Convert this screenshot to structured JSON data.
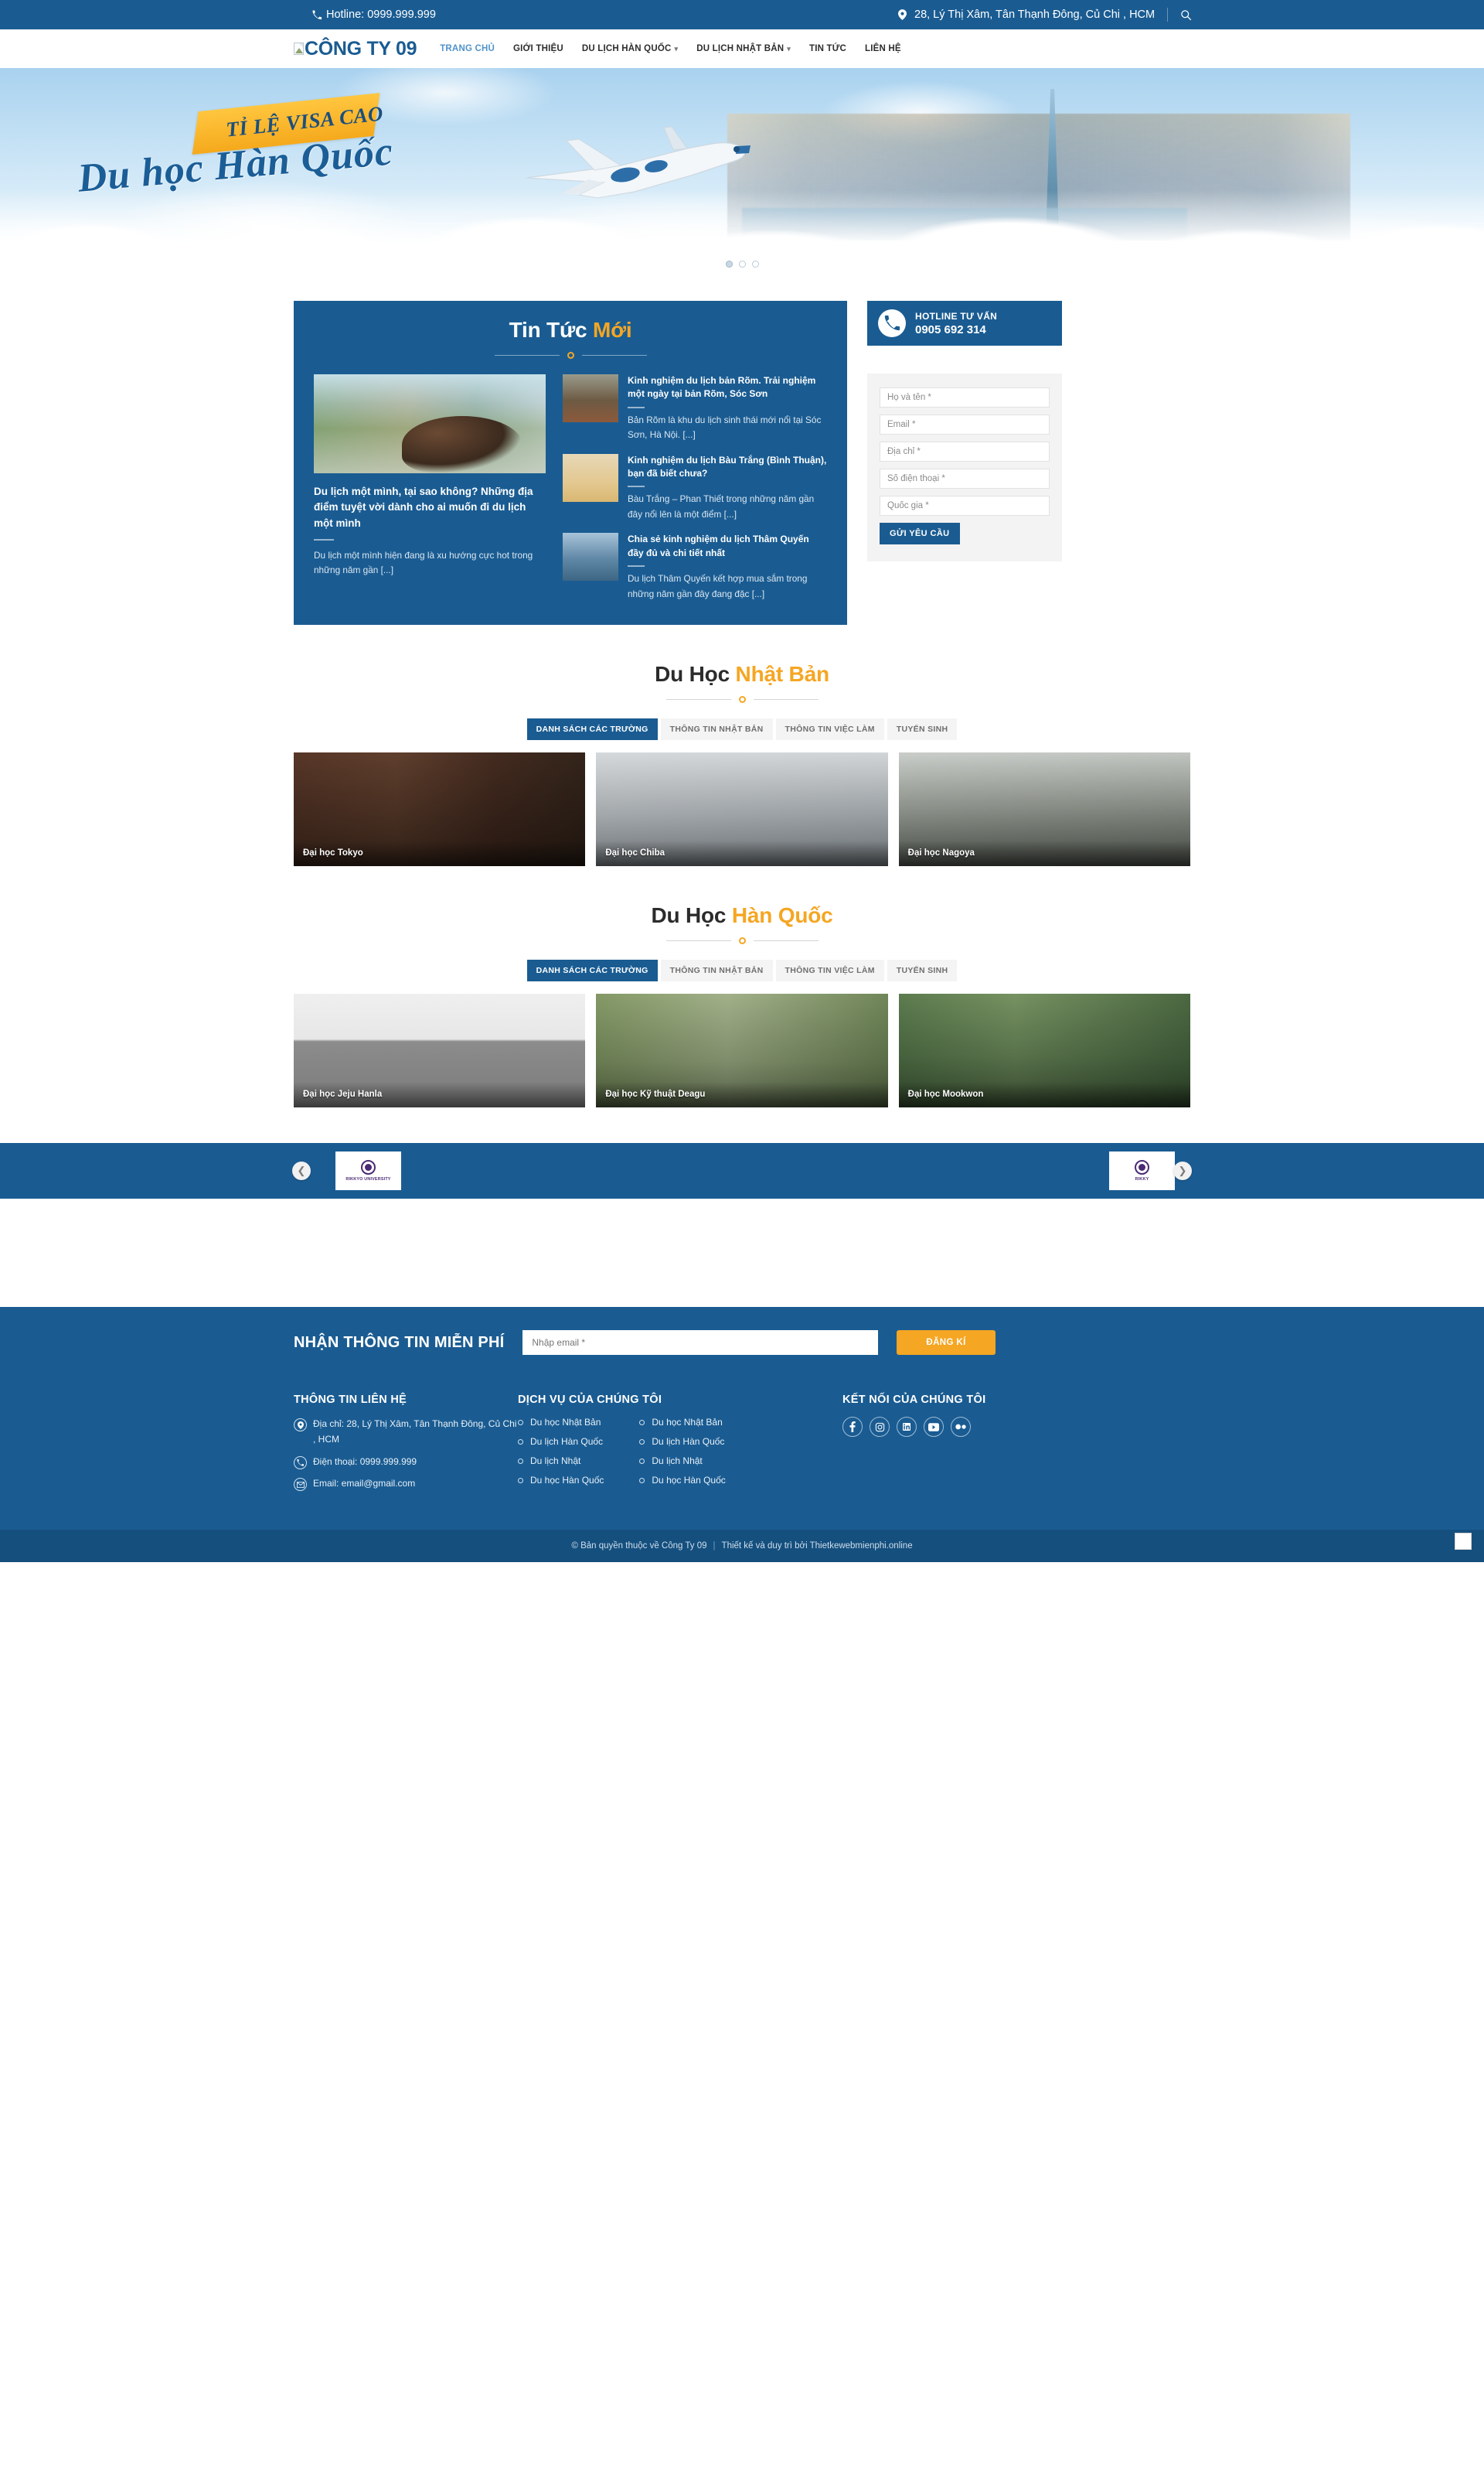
{
  "topbar": {
    "hotline": "Hotline: 0999.999.999",
    "address": "28, Lý Thị Xâm, Tân Thạnh Đông, Củ Chi , HCM",
    "phone_icon": "phone-icon",
    "pin_icon": "map-pin-icon",
    "search_icon": "search-icon"
  },
  "header": {
    "brand": "CÔNG TY 09",
    "nav": [
      {
        "label": "TRANG CHỦ",
        "active": true,
        "dropdown": false
      },
      {
        "label": "GIỚI THIỆU",
        "active": false,
        "dropdown": false
      },
      {
        "label": "DU LỊCH HÀN QUỐC",
        "active": false,
        "dropdown": true
      },
      {
        "label": "DU LỊCH NHẬT BẢN",
        "active": false,
        "dropdown": true
      },
      {
        "label": "TIN TỨC",
        "active": false,
        "dropdown": false
      },
      {
        "label": "LIÊN HỆ",
        "active": false,
        "dropdown": false
      }
    ]
  },
  "hero": {
    "ribbon": "TỈ LỆ VISA CAO",
    "title": "Du học Hàn Quốc",
    "dots": 3
  },
  "news": {
    "title_plain": "Tin Tức ",
    "title_accent": "Mới",
    "featured": {
      "headline": "Du lịch một mình, tại sao không? Những địa điểm tuyệt vời dành cho ai muốn đi du lịch một mình",
      "excerpt": "Du lịch một mình hiện đang là xu hướng cực hot trong những năm gần [...]"
    },
    "items": [
      {
        "headline": "Kinh nghiệm du lịch bản Rõm. Trải nghiệm một ngày tại bản Rõm, Sóc Sơn",
        "excerpt": "Bản Rõm là khu du lịch sinh thái mới nổi tại Sóc Sơn, Hà Nội. [...]"
      },
      {
        "headline": "Kinh nghiệm du lịch Bàu Trắng (Bình Thuận), bạn đã biết chưa?",
        "excerpt": "Bàu Trắng – Phan Thiết trong những năm gần đây nổi lên là một điểm [...]"
      },
      {
        "headline": "Chia sẻ kinh nghiệm du lịch Thâm Quyến đầy đủ và chi tiết nhất",
        "excerpt": "Du lịch Thâm Quyến kết hợp mua sắm trong những năm gần đây đang đặc [...]"
      }
    ]
  },
  "aside": {
    "hotline_label": "HOTLINE TƯ VẤN",
    "hotline_number": "0905 692 314",
    "form": {
      "fields": [
        {
          "name": "fullname",
          "placeholder": "Họ và tên *",
          "value": ""
        },
        {
          "name": "email",
          "placeholder": "Email *",
          "value": ""
        },
        {
          "name": "address",
          "placeholder": "Địa chỉ *",
          "value": ""
        },
        {
          "name": "phone",
          "placeholder": "Số điện thoại *",
          "value": ""
        },
        {
          "name": "country",
          "placeholder": "Quốc gia *",
          "value": ""
        }
      ],
      "submit_label": "GỬI YÊU CẦU"
    }
  },
  "study_japan": {
    "title_plain": "Du Học ",
    "title_accent": "Nhật Bản",
    "tabs": [
      {
        "label": "DANH SÁCH CÁC TRƯỜNG",
        "active": true
      },
      {
        "label": "THÔNG TIN NHẬT BẢN",
        "active": false
      },
      {
        "label": "THÔNG TIN VIỆC LÀM",
        "active": false
      },
      {
        "label": "TUYỂN SINH",
        "active": false
      }
    ],
    "cards": [
      {
        "caption": "Đại học Tokyo"
      },
      {
        "caption": "Đại học Chiba"
      },
      {
        "caption": "Đại học Nagoya"
      }
    ]
  },
  "study_korea": {
    "title_plain": "Du Học ",
    "title_accent": "Hàn Quốc",
    "tabs": [
      {
        "label": "DANH SÁCH CÁC TRƯỜNG",
        "active": true
      },
      {
        "label": "THÔNG TIN NHẬT BẢN",
        "active": false
      },
      {
        "label": "THÔNG TIN VIỆC LÀM",
        "active": false
      },
      {
        "label": "TUYỂN SINH",
        "active": false
      }
    ],
    "cards": [
      {
        "caption": "Đại học Jeju Hanla"
      },
      {
        "caption": "Đại học Kỹ thuật Deagu"
      },
      {
        "caption": "Đại học Mookwon"
      }
    ]
  },
  "partners": {
    "logos": [
      {
        "name": "RIKKYO UNIVERSITY"
      },
      {
        "name": "RIKKY"
      }
    ],
    "prev_icon": "chevron-left-icon",
    "next_icon": "chevron-right-icon"
  },
  "subscribe": {
    "title": "NHẬN THÔNG TIN MIỄN PHÍ",
    "placeholder": "Nhập email *",
    "value": "",
    "button": "ĐĂNG KÍ"
  },
  "footer": {
    "contact": {
      "title": "THÔNG TIN LIÊN HỆ",
      "address": "Địa chỉ: 28, Lý Thị Xâm, Tân Thạnh Đông, Củ Chi , HCM",
      "phone": "Điện thoại: 0999.999.999",
      "email": "Email: email@gmail.com"
    },
    "services": {
      "title": "DỊCH VỤ CỦA CHÚNG TÔI",
      "col1": [
        "Du học Nhật Bản",
        "Du lịch Hàn Quốc",
        "Du lịch Nhật",
        "Du học Hàn Quốc"
      ],
      "col2": [
        "Du học Nhật Bản",
        "Du lịch Hàn Quốc",
        "Du lịch Nhật",
        "Du học Hàn Quốc"
      ]
    },
    "social": {
      "title": "KẾT NỐI CỦA CHÚNG TÔI",
      "items": [
        "facebook-icon",
        "instagram-icon",
        "linkedin-icon",
        "youtube-icon",
        "flickr-icon"
      ]
    }
  },
  "copyright": {
    "left": "© Bản quyền thuộc về Công Ty 09",
    "right_prefix": "Thiết kế và duy trì bởi ",
    "right_link": "Thietkewebmienphi.online"
  },
  "colors": {
    "brand_blue": "#1a5c92",
    "accent_orange": "#f5a623",
    "footer_blue": "#154f7e"
  }
}
